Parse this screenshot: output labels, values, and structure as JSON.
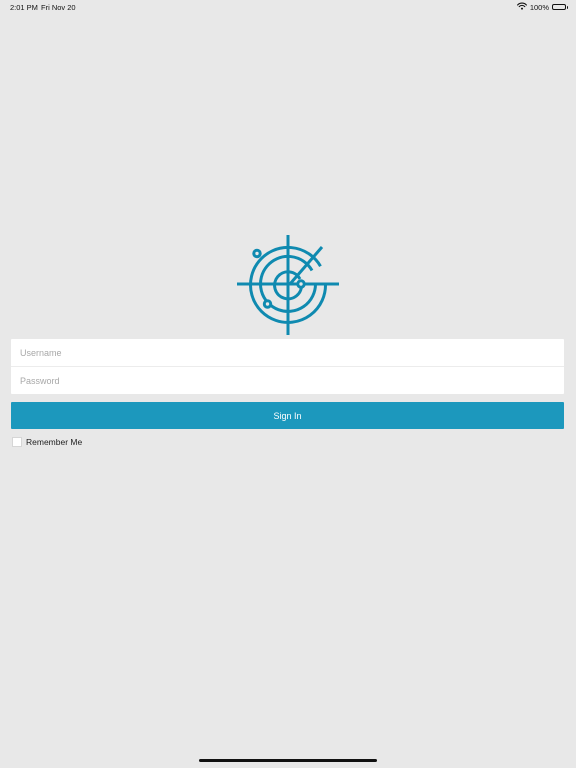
{
  "status_bar": {
    "time": "2:01 PM",
    "date": "Fri Nov 20",
    "battery_text": "100%",
    "wifi_icon": "wifi-icon",
    "battery_icon": "battery-icon"
  },
  "logo": {
    "icon": "radar-logo-icon",
    "color": "#0f8ab0"
  },
  "form": {
    "username_placeholder": "Username",
    "username_value": "",
    "password_placeholder": "Password",
    "password_value": ""
  },
  "sign_in": {
    "label": "Sign In",
    "color": "#1c98bd"
  },
  "remember_me": {
    "label": "Remember Me",
    "checked": false
  }
}
